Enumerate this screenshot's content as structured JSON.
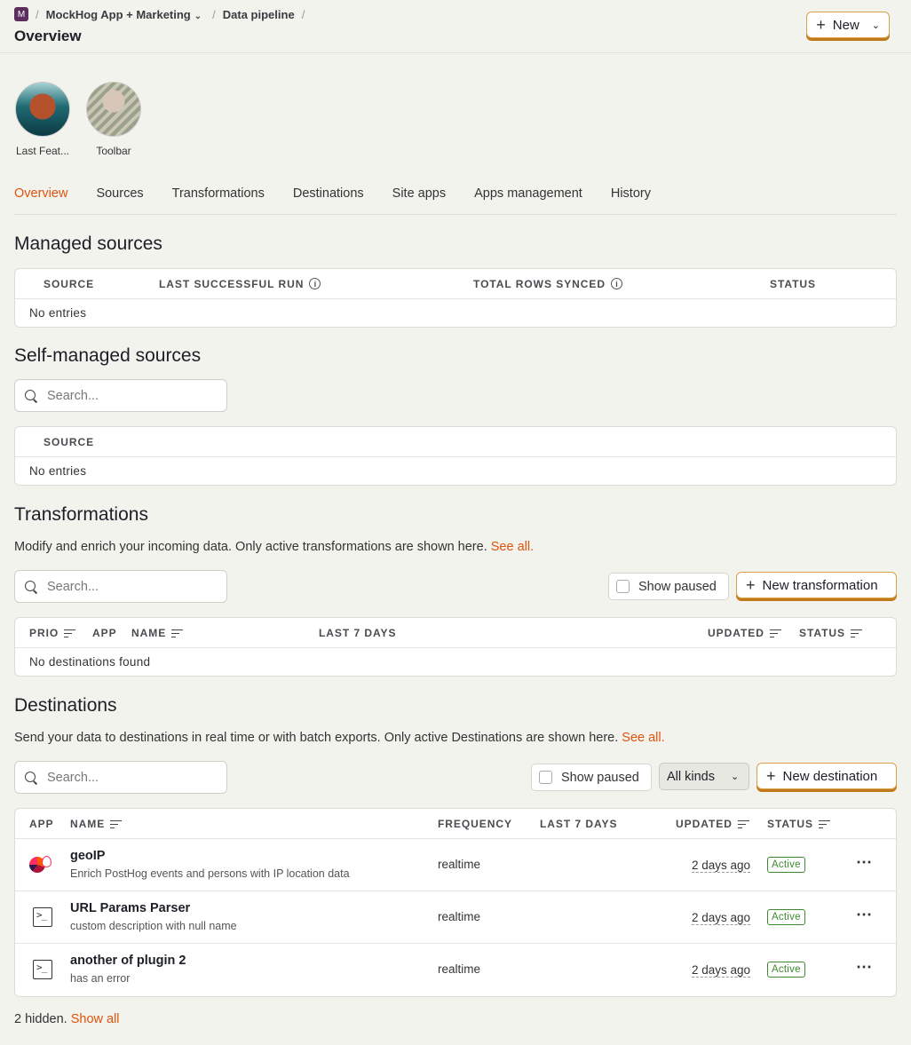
{
  "breadcrumb": {
    "org_initial": "M",
    "project": "MockHog App + Marketing",
    "section": "Data pipeline"
  },
  "page_title": "Overview",
  "new_button": "New",
  "apps": [
    {
      "label": "Last Feat..."
    },
    {
      "label": "Toolbar"
    }
  ],
  "tabs": [
    "Overview",
    "Sources",
    "Transformations",
    "Destinations",
    "Site apps",
    "Apps management",
    "History"
  ],
  "managed_sources": {
    "title": "Managed sources",
    "columns": [
      "SOURCE",
      "LAST SUCCESSFUL RUN",
      "TOTAL ROWS SYNCED",
      "STATUS"
    ],
    "empty": "No entries"
  },
  "self_managed": {
    "title": "Self-managed sources",
    "search_placeholder": "Search...",
    "columns": [
      "SOURCE"
    ],
    "empty": "No entries"
  },
  "transformations": {
    "title": "Transformations",
    "description": "Modify and enrich your incoming data. Only active transformations are shown here.",
    "see_all": "See all.",
    "search_placeholder": "Search...",
    "show_paused": "Show paused",
    "new_button": "New transformation",
    "columns": [
      "PRIO",
      "APP",
      "NAME",
      "LAST 7 DAYS",
      "UPDATED",
      "STATUS"
    ],
    "empty": "No destinations found"
  },
  "destinations": {
    "title": "Destinations",
    "description": "Send your data to destinations in real time or with batch exports. Only active Destinations are shown here.",
    "see_all": "See all.",
    "search_placeholder": "Search...",
    "show_paused": "Show paused",
    "kinds_select": "All kinds",
    "new_button": "New destination",
    "columns": [
      "APP",
      "NAME",
      "FREQUENCY",
      "LAST 7 DAYS",
      "UPDATED",
      "STATUS"
    ],
    "rows": [
      {
        "icon": "geoip-icon",
        "name": "geoIP",
        "description": "Enrich PostHog events and persons with IP location data",
        "frequency": "realtime",
        "updated": "2 days ago",
        "status": "Active"
      },
      {
        "icon": "terminal-icon",
        "name": "URL Params Parser",
        "description": "custom description with null name",
        "frequency": "realtime",
        "updated": "2 days ago",
        "status": "Active"
      },
      {
        "icon": "terminal-icon",
        "name": "another of plugin 2",
        "description": "has an error",
        "frequency": "realtime",
        "updated": "2 days ago",
        "status": "Active"
      }
    ],
    "hidden_text": "2 hidden.",
    "show_all": "Show all"
  },
  "colors": {
    "accent": "#e0520c",
    "active": "#3d8a2e",
    "background": "#f3f3ee"
  }
}
